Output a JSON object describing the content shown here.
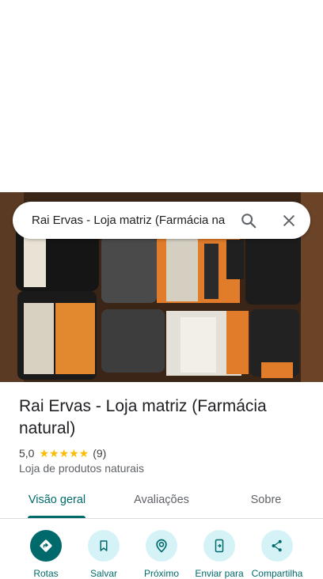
{
  "search": {
    "query": "Rai Ervas - Loja matriz (Farmácia na"
  },
  "place": {
    "title": "Rai Ervas - Loja matriz (Farmácia natural)",
    "rating": "5,0",
    "stars": "★★★★★",
    "review_count": "(9)",
    "category": "Loja de produtos naturais"
  },
  "tabs": [
    {
      "label": "Visão geral",
      "active": true
    },
    {
      "label": "Avaliações",
      "active": false
    },
    {
      "label": "Sobre",
      "active": false
    }
  ],
  "actions": [
    {
      "label": "Rotas",
      "icon": "directions-icon"
    },
    {
      "label": "Salvar",
      "icon": "bookmark-icon"
    },
    {
      "label": "Próximo",
      "icon": "nearby-icon"
    },
    {
      "label": "Enviar para",
      "icon": "send-to-phone-icon"
    },
    {
      "label": "Compartilha",
      "icon": "share-icon"
    }
  ],
  "colors": {
    "accent": "#006b6b",
    "action_bg": "#d5f3f7",
    "star": "#fbbc04"
  }
}
